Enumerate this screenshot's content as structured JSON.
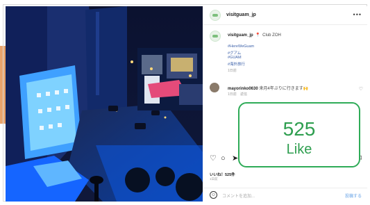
{
  "header": {
    "username": "visitguam_jp",
    "more_label": "•••"
  },
  "caption": {
    "username": "visitguam_jp",
    "location": "Club ZOH",
    "hashtags": [
      "#HereWeGuam",
      "#グアム",
      "#GUAM",
      "#海外旅行"
    ],
    "time": "1日前"
  },
  "comment": {
    "username": "mayorinko0630",
    "text": "来月4年ぶりに行きます🙌",
    "meta_time": "1日前",
    "meta_reply": "返信"
  },
  "post": {
    "likes_text": "いいね！525件",
    "date_text": "1日前"
  },
  "comment_bar": {
    "placeholder": "コメントを追加...",
    "post_label": "投稿する"
  },
  "highlight": {
    "count": "525",
    "label": "Like"
  },
  "colors": {
    "accent_green": "#2e9e4f",
    "hashtag_blue": "#3a5fa8"
  },
  "icons": [
    "more-icon",
    "location-pin-icon",
    "heart-icon",
    "comment-icon",
    "share-icon",
    "bookmark-icon",
    "emoji-icon"
  ]
}
